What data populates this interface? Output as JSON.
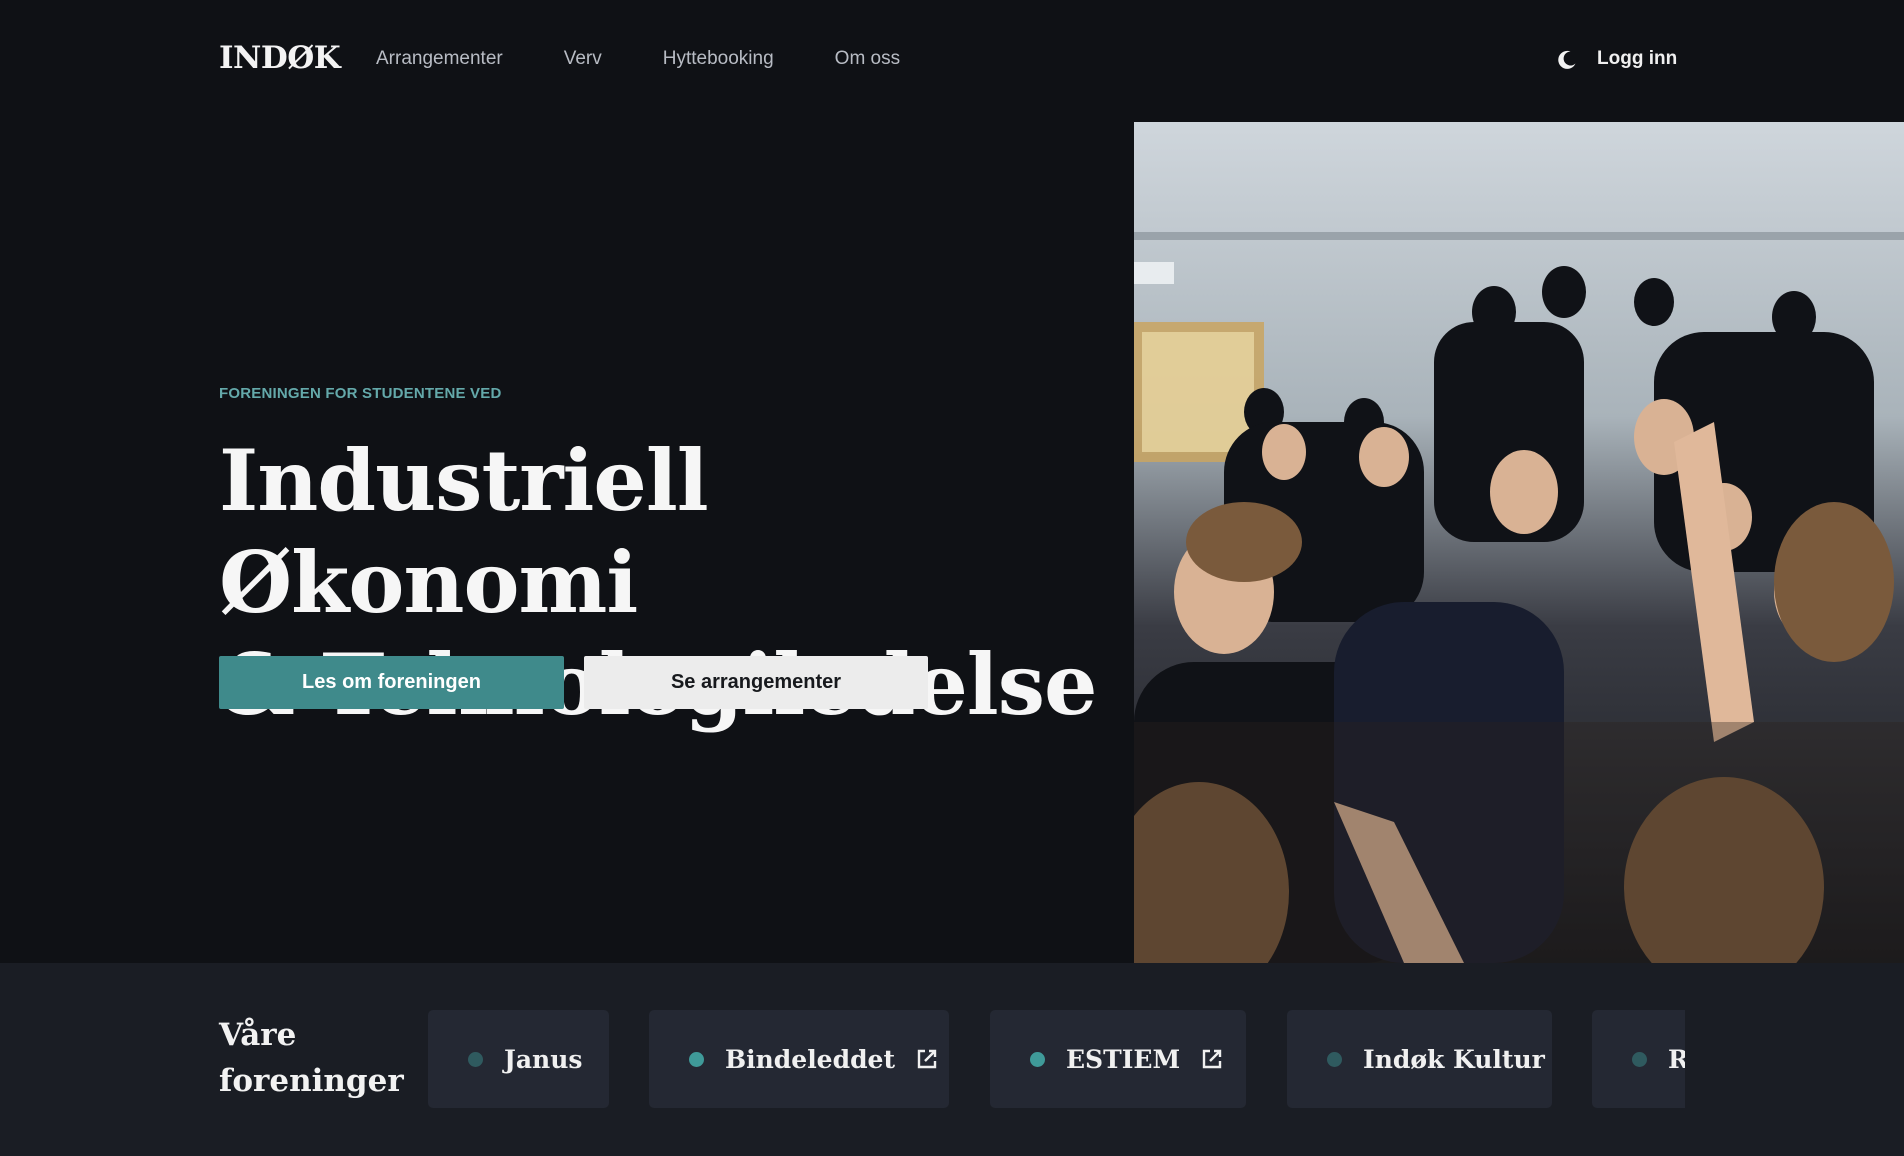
{
  "header": {
    "logo": "INDØK",
    "nav": [
      {
        "label": "Arrangementer"
      },
      {
        "label": "Verv"
      },
      {
        "label": "Hyttebooking"
      },
      {
        "label": "Om oss"
      }
    ],
    "theme_icon": "moon-icon",
    "login_label": "Logg inn"
  },
  "hero": {
    "eyebrow": "FORENINGEN FOR STUDENTENE VED",
    "title_line1": "Industriell Økonomi",
    "title_line2": "& Teknologiledelse",
    "primary_button": "Les om foreningen",
    "secondary_button": "Se arrangementer"
  },
  "orgs": {
    "title": "Våre foreninger",
    "items": [
      {
        "name": "Janus",
        "dot_color": "#2f5a5f",
        "external": false
      },
      {
        "name": "Bindeleddet",
        "dot_color": "#3f9a99",
        "external": true
      },
      {
        "name": "ESTIEM",
        "dot_color": "#3f9a99",
        "external": true
      },
      {
        "name": "Indøk Kultur",
        "dot_color": "#2f5a5f",
        "external": false
      },
      {
        "name": "R",
        "dot_color": "#2f5a5f",
        "external": false
      }
    ]
  },
  "colors": {
    "background": "#0f1115",
    "accent": "#3f8a8b",
    "eyebrow": "#64a9aa",
    "section_background": "#1a1d24",
    "card_background": "#242833"
  }
}
